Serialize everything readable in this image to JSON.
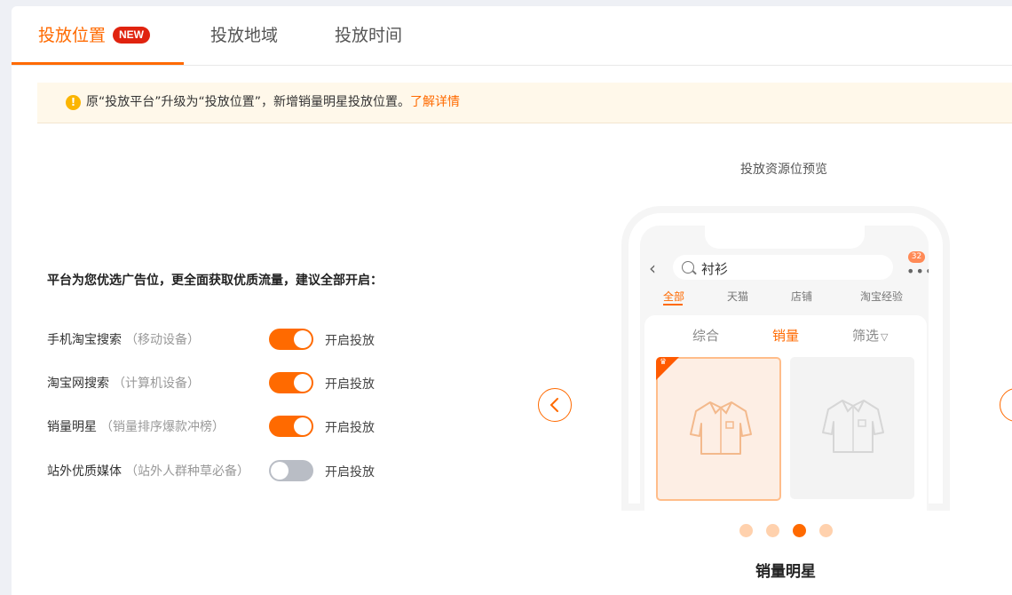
{
  "tabs": [
    {
      "label": "投放位置",
      "badge": "NEW",
      "active": true
    },
    {
      "label": "投放地域",
      "active": false
    },
    {
      "label": "投放时间",
      "active": false
    }
  ],
  "notice": {
    "icon": "warning-icon",
    "text": "原“投放平台”升级为“投放位置”，新增销量明星投放位置。",
    "link": "了解详情"
  },
  "settings": {
    "intro": "平台为您优选广告位，更全面获取优质流量，建议全部开启：",
    "rows": [
      {
        "name": "手机淘宝搜索",
        "sub": "（移动设备）",
        "enabled": true,
        "state_label": "开启投放"
      },
      {
        "name": "淘宝网搜索",
        "sub": "（计算机设备）",
        "enabled": true,
        "state_label": "开启投放"
      },
      {
        "name": "销量明星",
        "sub": "（销量排序爆款冲榜）",
        "enabled": true,
        "state_label": "开启投放"
      },
      {
        "name": "站外优质媒体",
        "sub": "（站外人群种草必备）",
        "enabled": false,
        "state_label": "开启投放"
      }
    ]
  },
  "preview": {
    "title": "投放资源位预览",
    "phone": {
      "search_query": "衬衫",
      "badge_count": "32",
      "categories": [
        "全部",
        "天猫",
        "店铺",
        "淘宝经验"
      ],
      "active_category": "全部",
      "sort_options": [
        "综合",
        "销量",
        "筛选"
      ],
      "active_sort": "销量"
    },
    "carousel": {
      "count": 4,
      "active_index": 2
    },
    "caption": "销量明星",
    "colors": {
      "accent": "#ff6a00",
      "badge": "#e0230f",
      "toggle_off": "#b9bdc5"
    }
  }
}
